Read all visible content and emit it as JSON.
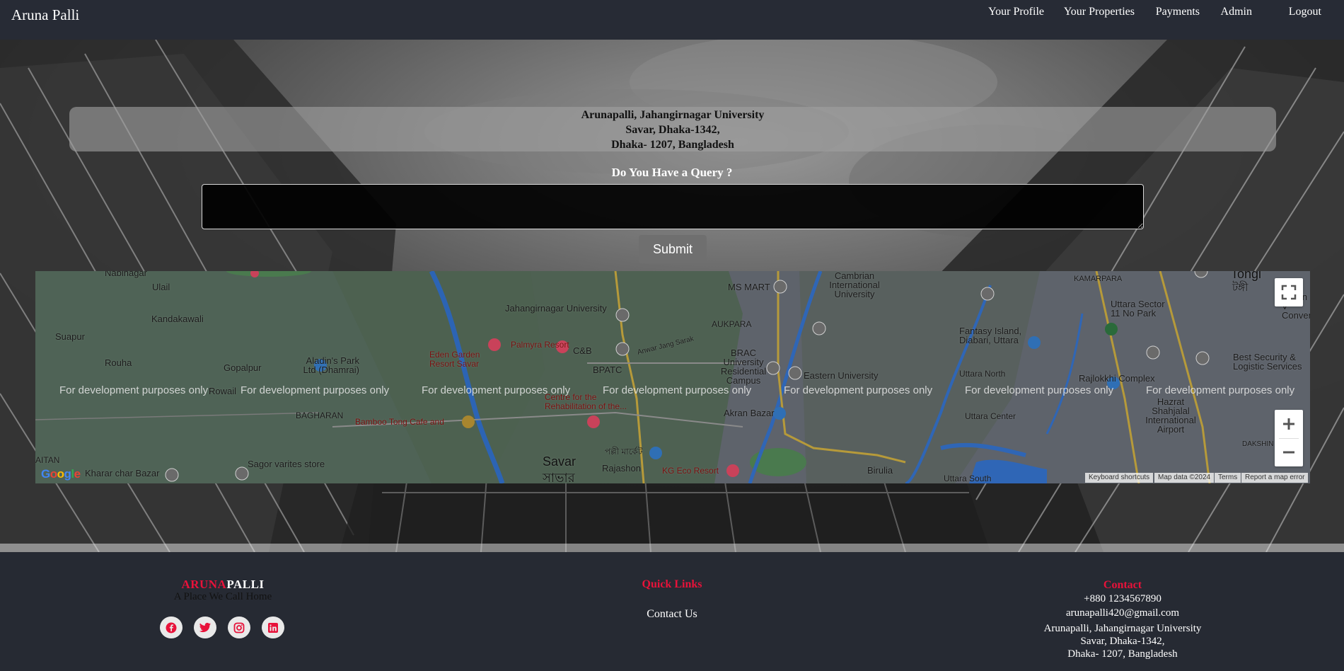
{
  "navbar": {
    "brand": "Aruna Palli",
    "links": [
      {
        "label": "Your Profile"
      },
      {
        "label": "Your Properties"
      },
      {
        "label": "Payments"
      },
      {
        "label": "Admin"
      },
      {
        "label": "Logout"
      }
    ]
  },
  "address": {
    "line1": "Arunapalli, Jahangirnagar University",
    "line2": "Savar, Dhaka-1342,",
    "line3": "Dhaka- 1207, Bangladesh"
  },
  "query": {
    "title": "Do You Have a Query ?",
    "textarea_value": "",
    "submit_label": "Submit"
  },
  "map": {
    "dev_watermark": "For development purposes only",
    "labels": {
      "nabinagar": "Nabinagar",
      "ulail": "Ulail",
      "kandakawali": "Kandakawali",
      "suapur": "Suapur",
      "rouha": "Rouha",
      "gopalpur": "Gopalpur",
      "rowail": "Rowail",
      "bagharan": "BAGHARAN",
      "kaitan": "AITAN",
      "jahangirnagar": "Jahangirnagar University",
      "palmyra": "Palmyra Resort",
      "eden_garden": "Eden Garden Resort Savar",
      "cnb": "C&B",
      "bpatc": "BPATC",
      "anwar_jang": "Anwar Jang Sarak",
      "crp": "Centre for the Rehabilitation of the...",
      "aladins": "Aladin's Park Ltd (Dhamrai)",
      "bamboo": "Bamboo Tong Cafe and",
      "sagor": "Sagor varites store",
      "kharar": "Kharar char Bazar",
      "savar": "Savar",
      "savar_bn": "সাভার",
      "rajashon": "Rajashon",
      "kg_eco": "KG Eco Resort",
      "ms_mart": "MS MART",
      "cambrian": "Cambrian International University",
      "aukpara": "AUKPARA",
      "brac": "BRAC University Residential Campus",
      "eastern": "Eastern University",
      "akran": "Akran Bazar",
      "birulia": "Birulia",
      "fantasy": "Fantasy Island, Diabari, Uttara",
      "uttara_north": "Uttara North",
      "uttara_center": "Uttara Center",
      "uttara_south": "Uttara South",
      "kamarpara": "KAMARPARA",
      "uttara_sector": "Uttara Sector 11 No Park",
      "tongi": "Tongi",
      "tongi_bn": "টঙ্গী",
      "green_view": "Green V Conven",
      "best_security": "Best Security & Logistic Services",
      "rajlokkhi": "Rajlokkhi Complex",
      "hazrat": "Hazrat Shahjalal International Airport",
      "dakshin": "DAKSHIN KH",
      "palli_market": "পল্লী মার্কেট"
    },
    "footer": {
      "keyboard": "Keyboard shortcuts",
      "mapdata": "Map data ©2024",
      "terms": "Terms",
      "report": "Report a map error"
    },
    "google": "Google"
  },
  "footer": {
    "brand_red": "ARUNA",
    "brand_white": "PALLI",
    "tagline": "A Place We Call Home",
    "social_icons": [
      "facebook-icon",
      "twitter-icon",
      "instagram-icon",
      "linkedin-icon"
    ],
    "quick_links_title": "Quick Links",
    "quick_links": [
      {
        "label": "Contact Us"
      }
    ],
    "contact_title": "Contact",
    "phone": "+880 1234567890",
    "email": "arunapalli420@gmail.com",
    "address_line1": "Arunapalli, Jahangirnagar University",
    "address_line2": "Savar, Dhaka-1342,",
    "address_line3": "Dhaka- 1207, Bangladesh"
  },
  "colors": {
    "accent_red": "#e8123a",
    "nav_bg": "#272b35",
    "footer_bg": "#262a33"
  }
}
